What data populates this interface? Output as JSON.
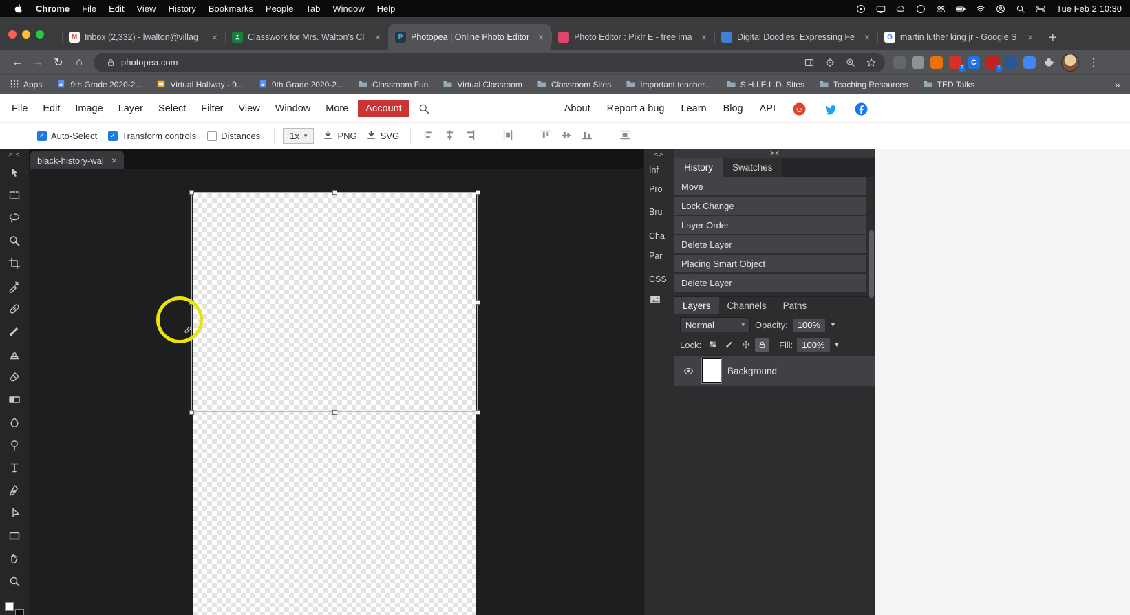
{
  "glyphs": {
    "back": "←",
    "forward": "→",
    "reload": "↻",
    "home": "⌂",
    "dots": "⋮",
    "close": "×",
    "check": "✓",
    "caret_small": "▾",
    "caret_down": "▼",
    "plus": "+"
  },
  "macos": {
    "menus": [
      "Chrome",
      "File",
      "Edit",
      "View",
      "History",
      "Bookmarks",
      "People",
      "Tab",
      "Window",
      "Help"
    ],
    "status_icons": [
      "record",
      "display",
      "cloud",
      "circle",
      "users",
      "battery",
      "wifi",
      "user",
      "search",
      "control-center"
    ],
    "clock": "Tue Feb 2 10:30"
  },
  "chrome": {
    "tabs": [
      {
        "title": "Inbox (2,332) - lwalton@villag",
        "fav": "gmail",
        "active": false
      },
      {
        "title": "Classwork for Mrs. Walton's Cl",
        "fav": "classroom",
        "active": false
      },
      {
        "title": "Photopea | Online Photo Editor",
        "fav": "photopea",
        "active": true
      },
      {
        "title": "Photo Editor : Pixlr E - free ima",
        "fav": "pixlr",
        "active": false
      },
      {
        "title": "Digital Doodles: Expressing Fe",
        "fav": "doodles",
        "active": false
      },
      {
        "title": "martin luther king jr - Google S",
        "fav": "google",
        "active": false
      }
    ],
    "url": "photopea.com",
    "extensions": [
      {
        "color": "#63666a"
      },
      {
        "color": "#8d9094"
      },
      {
        "color": "#e8710a"
      },
      {
        "color": "#d93025",
        "badge": "2"
      },
      {
        "color": "#1a73e8",
        "letter": "C"
      },
      {
        "color": "#c5221f",
        "badge": "1"
      },
      {
        "color": "#2b5797"
      },
      {
        "color": "#4285f4"
      }
    ],
    "bookmarks": [
      {
        "label": "Apps",
        "icon": "grid"
      },
      {
        "label": "9th Grade 2020-2...",
        "icon": "doc"
      },
      {
        "label": "Virtual Hallway - 9...",
        "icon": "slide"
      },
      {
        "label": "9th Grade 2020-2...",
        "icon": "doc"
      },
      {
        "label": "Classroom Fun",
        "icon": "folder"
      },
      {
        "label": "Virtual Classroom",
        "icon": "folder"
      },
      {
        "label": "Classroom Sites",
        "icon": "folder"
      },
      {
        "label": "Important teacher...",
        "icon": "folder"
      },
      {
        "label": "S.H.I.E.L.D. Sites",
        "icon": "folder"
      },
      {
        "label": "Teaching Resources",
        "icon": "folder"
      },
      {
        "label": "TED Talks",
        "icon": "folder"
      }
    ],
    "overflow": "»"
  },
  "photopea": {
    "menus": [
      "File",
      "Edit",
      "Image",
      "Layer",
      "Select",
      "Filter",
      "View",
      "Window",
      "More"
    ],
    "account": "Account",
    "links": [
      "About",
      "Report a bug",
      "Learn",
      "Blog",
      "API"
    ],
    "options": {
      "checkboxes": [
        {
          "label": "Auto-Select",
          "checked": true
        },
        {
          "label": "Transform controls",
          "checked": true
        },
        {
          "label": "Distances",
          "checked": false
        }
      ],
      "zoom": "1x",
      "exports": [
        "PNG",
        "SVG"
      ],
      "align_icons": [
        "align-left",
        "align-center-h",
        "align-right",
        "distribute-v",
        "align-top",
        "align-middle",
        "align-bottom",
        "distribute-h"
      ]
    },
    "doc_tab": "black-history-wal",
    "collapse_left": "> <",
    "collapse_right": "<>",
    "collapse_panel": "><",
    "tools": [
      "move",
      "marquee",
      "lasso",
      "object-select",
      "crop",
      "eyedropper",
      "heal",
      "brush",
      "stamp",
      "eraser",
      "gradient",
      "blur",
      "dodge",
      "type",
      "pen",
      "path-select",
      "shape",
      "hand",
      "zoom-tool"
    ],
    "dock_panels": [
      "Inf",
      "Pro",
      "Bru",
      "Cha",
      "Par",
      "CSS"
    ],
    "history": {
      "tabs": [
        "History",
        "Swatches"
      ],
      "items": [
        "Move",
        "Lock Change",
        "Layer Order",
        "Delete Layer",
        "Placing Smart Object",
        "Delete Layer"
      ]
    },
    "layers": {
      "tabs": [
        "Layers",
        "Channels",
        "Paths"
      ],
      "blend_mode": "Normal",
      "opacity_label": "Opacity:",
      "opacity": "100%",
      "lock_label": "Lock:",
      "lock_icons": [
        "checker-lock",
        "brush-lock",
        "move-lock",
        "padlock"
      ],
      "fill_label": "Fill:",
      "fill": "100%",
      "items": [
        {
          "name": "Background",
          "visible": true
        }
      ]
    }
  }
}
